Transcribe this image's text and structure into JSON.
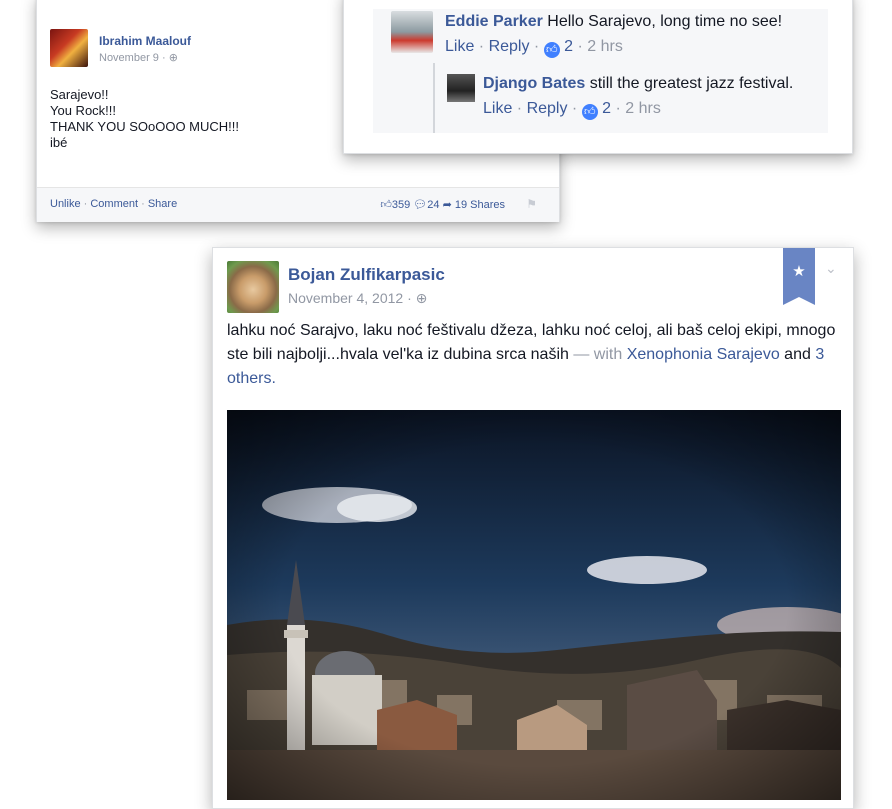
{
  "post_ibrahim": {
    "author": "Ibrahim Maalouf",
    "date": "November 9 ·",
    "privacy_icon": "globe-icon",
    "body_lines": [
      "Sarajevo!!",
      "You Rock!!!",
      "THANK YOU SOoOOO MUCH!!!",
      "ibé"
    ],
    "actions": {
      "unlike": "Unlike",
      "comment": "Comment",
      "share": "Share",
      "sep": " · "
    },
    "stats": {
      "likes": "359",
      "comments": "24",
      "shares": "19 Shares"
    }
  },
  "comments": [
    {
      "author": "Eddie Parker",
      "text": " Hello Sarajevo, long time no see!",
      "like": "Like",
      "reply": "Reply",
      "likes": "2",
      "time": "2 hrs"
    },
    {
      "author": "Django Bates",
      "text": " still the greatest jazz festival.",
      "like": "Like",
      "reply": "Reply",
      "likes": "2",
      "time": "2 hrs"
    }
  ],
  "post_bojan": {
    "author": "Bojan Zulfikarpasic",
    "date": "November 4, 2012 ·",
    "text_main": "lahku noć Sarajvo, laku noć feštivalu džeza, lahku noć celoj, ali baš celoj ekipi, mnogo ste bili najbolji...hvala vel'ka iz dubina srca naših",
    "with": " — with ",
    "tag1": "Xenophonia Sarajevo",
    "and": " and ",
    "tag2": "3 others",
    "end": ".",
    "bookmark_icon": "star-icon",
    "menu_icon": "chevron-down-icon"
  },
  "colors": {
    "link": "#3b5998",
    "meta": "#9197a3",
    "like_badge": "#4080ff",
    "bookmark": "#6985c4"
  }
}
